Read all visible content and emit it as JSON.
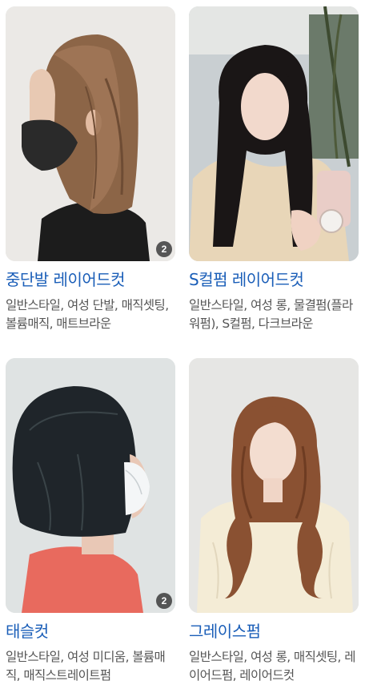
{
  "results": [
    {
      "title": "중단발 레이어드컷",
      "tags": "일반스타일, 여성 단발, 매직셋팅, 볼륨매직, 매트브라운",
      "image_count": "2",
      "image_icon": "hair-photo-icon"
    },
    {
      "title": "S컬펌 레이어드컷",
      "tags": "일반스타일, 여성 롱, 물결펌(플라워펌), S컬펌, 다크브라운",
      "image_count": "",
      "image_icon": "hair-photo-icon"
    },
    {
      "title": "태슬컷",
      "tags": "일반스타일, 여성 미디움, 볼륨매직, 매직스트레이트펌",
      "image_count": "2",
      "image_icon": "hair-photo-icon"
    },
    {
      "title": "그레이스펌",
      "tags": "일반스타일, 여성 롱, 매직셋팅, 레이어드펌, 레이어드컷",
      "image_count": "",
      "image_icon": "hair-photo-icon"
    }
  ]
}
